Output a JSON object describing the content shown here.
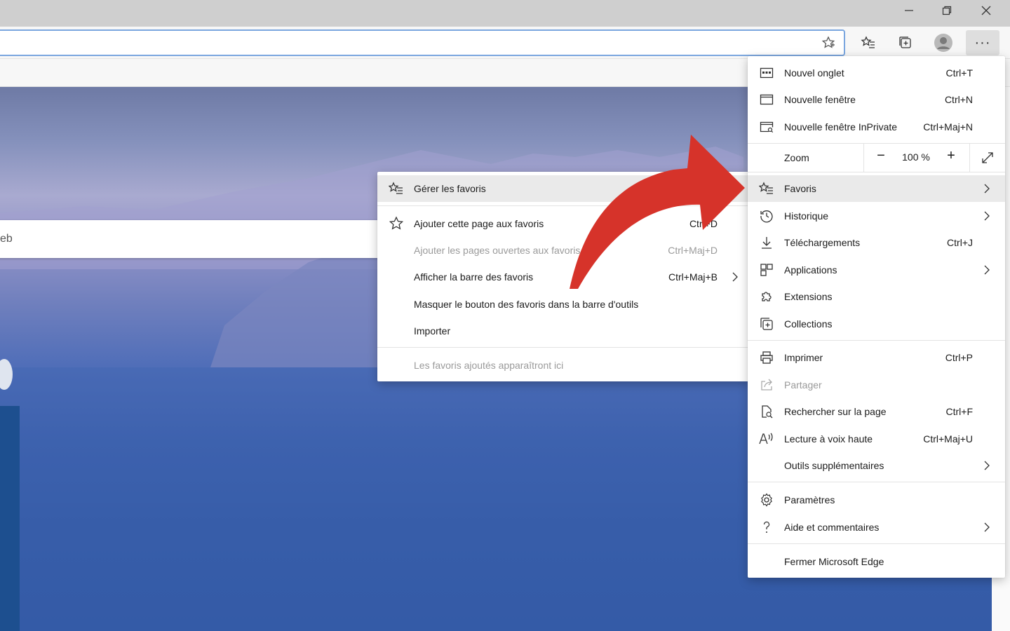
{
  "page": {
    "search_partial_text": "eb"
  },
  "main_menu": {
    "items_top": [
      {
        "label": "Nouvel onglet",
        "shortcut": "Ctrl+T",
        "icon": "new-tab-icon"
      },
      {
        "label": "Nouvelle fenêtre",
        "shortcut": "Ctrl+N",
        "icon": "new-window-icon"
      },
      {
        "label": "Nouvelle fenêtre InPrivate",
        "shortcut": "Ctrl+Maj+N",
        "icon": "inprivate-icon"
      }
    ],
    "zoom": {
      "label": "Zoom",
      "value": "100 %",
      "minus": "−",
      "plus": "+"
    },
    "items_mid": [
      {
        "label": "Favoris",
        "shortcut": "",
        "icon": "favorites-icon",
        "submenu": true
      },
      {
        "label": "Historique",
        "shortcut": "",
        "icon": "history-icon",
        "submenu": true
      },
      {
        "label": "Téléchargements",
        "shortcut": "Ctrl+J",
        "icon": "download-icon"
      },
      {
        "label": "Applications",
        "shortcut": "",
        "icon": "apps-icon",
        "submenu": true
      },
      {
        "label": "Extensions",
        "shortcut": "",
        "icon": "extensions-icon"
      },
      {
        "label": "Collections",
        "shortcut": "",
        "icon": "collections-icon"
      }
    ],
    "items_tools": [
      {
        "label": "Imprimer",
        "shortcut": "Ctrl+P",
        "icon": "print-icon"
      },
      {
        "label": "Partager",
        "shortcut": "",
        "icon": "share-icon",
        "disabled": true
      },
      {
        "label": "Rechercher sur la page",
        "shortcut": "Ctrl+F",
        "icon": "find-icon"
      },
      {
        "label": "Lecture à voix haute",
        "shortcut": "Ctrl+Maj+U",
        "icon": "read-aloud-icon"
      },
      {
        "label": "Outils supplémentaires",
        "shortcut": "",
        "icon": "",
        "submenu": true
      }
    ],
    "items_settings": [
      {
        "label": "Paramètres",
        "icon": "settings-icon"
      },
      {
        "label": "Aide et commentaires",
        "icon": "help-icon",
        "submenu": true
      }
    ],
    "close_label": "Fermer Microsoft Edge"
  },
  "favorites_menu": {
    "manage": "Gérer les favoris",
    "items": [
      {
        "label": "Ajouter cette page aux favoris",
        "shortcut": "Ctrl+D"
      },
      {
        "label": "Ajouter les pages ouvertes aux favoris",
        "shortcut": "Ctrl+Maj+D",
        "disabled": true
      },
      {
        "label": "Afficher la barre des favoris",
        "shortcut": "Ctrl+Maj+B",
        "submenu": true
      },
      {
        "label": "Masquer le bouton des favoris dans la barre d'outils",
        "shortcut": ""
      },
      {
        "label": "Importer",
        "shortcut": ""
      }
    ],
    "empty_note": "Les favoris ajoutés apparaîtront ici"
  },
  "colors": {
    "arrow": "#d6332a",
    "highlight": "#eaeaea",
    "disabled_text": "#9a9a9a"
  }
}
